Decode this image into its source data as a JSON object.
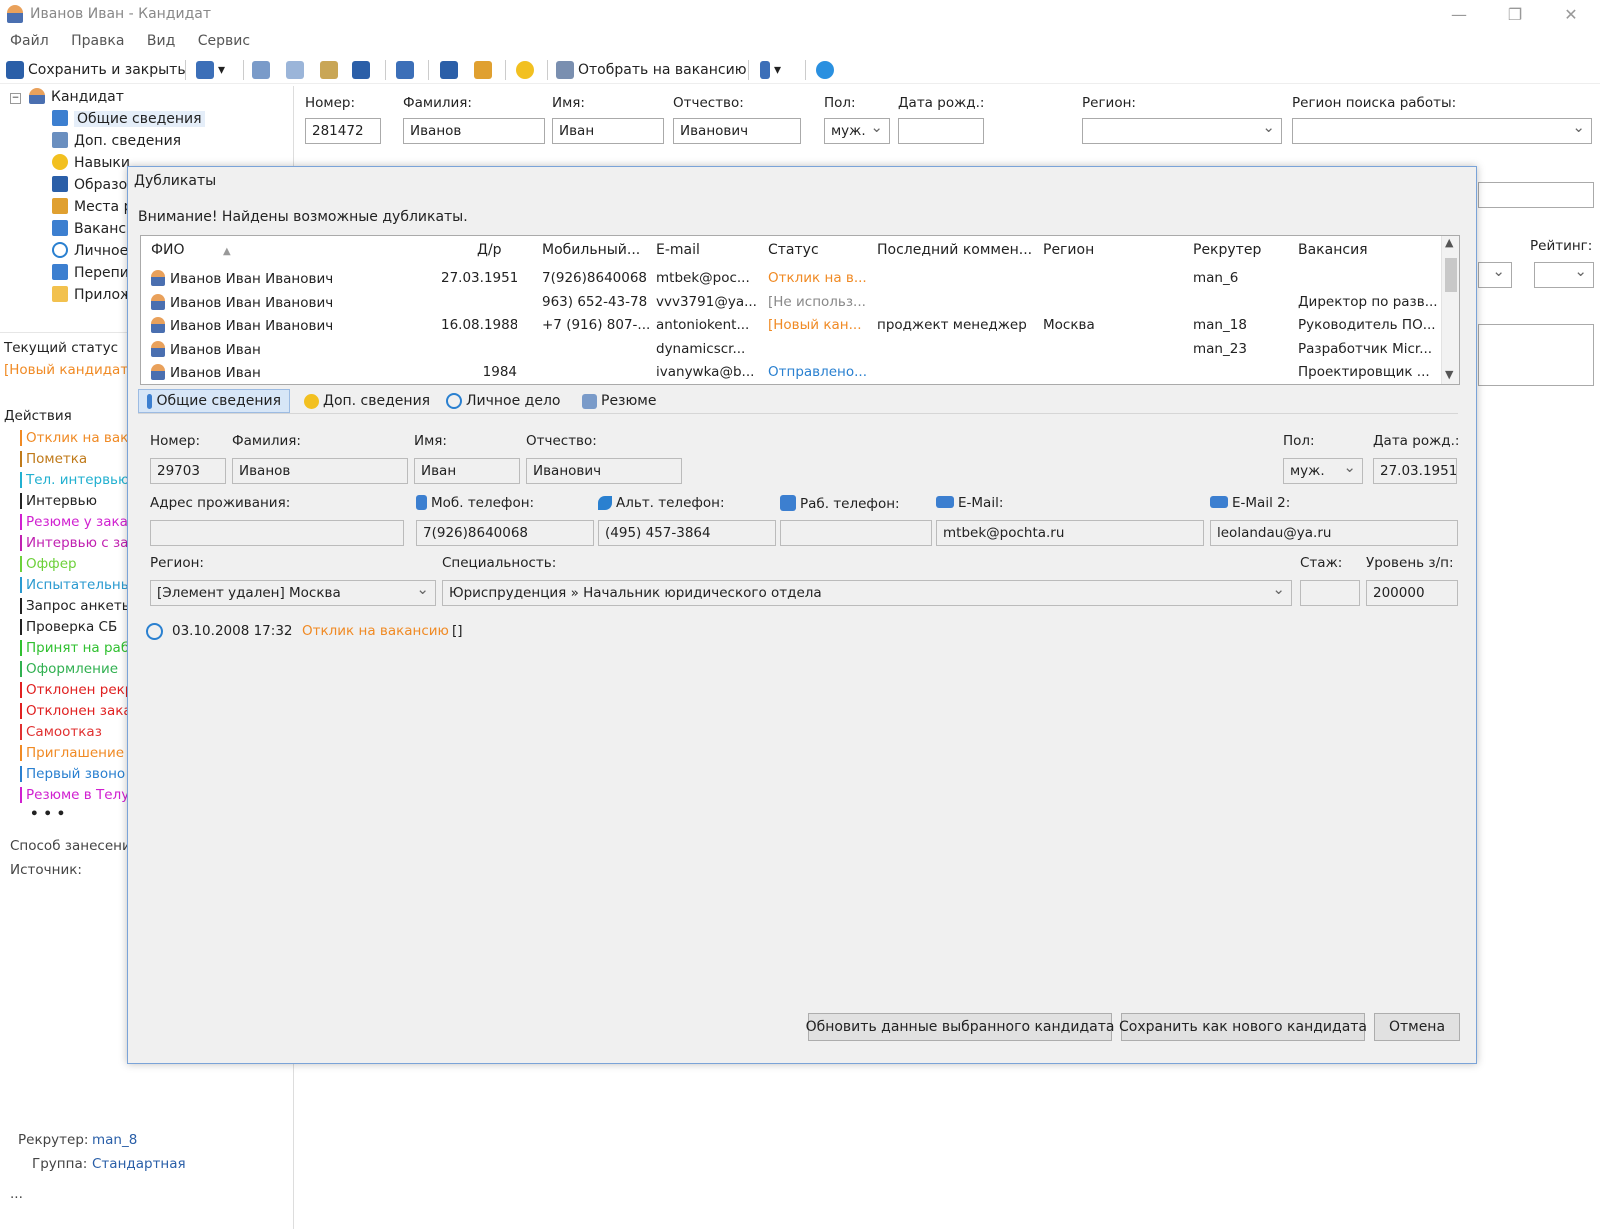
{
  "window": {
    "title": "Иванов Иван - Кандидат"
  },
  "menu": [
    "Файл",
    "Правка",
    "Вид",
    "Сервис"
  ],
  "toolbar": {
    "save_close": "Сохранить и закрыть",
    "assign_vacancy": "Отобрать на вакансию"
  },
  "tree": {
    "root": "Кандидат",
    "items": [
      "Общие сведения",
      "Доп. сведения",
      "Навыки",
      "Образо",
      "Места р",
      "Ваканс",
      "Личное",
      "Перепи",
      "Прилож"
    ]
  },
  "left": {
    "status_label": "Текущий статус",
    "status_value": "[Новый кандидат]",
    "actions_label": "Действия",
    "actions": [
      {
        "t": "Отклик на вака",
        "c": "#f08a24"
      },
      {
        "t": "Пометка",
        "c": "#c07a1a"
      },
      {
        "t": "Тел. интервью",
        "c": "#22b0d0"
      },
      {
        "t": "Интервью",
        "c": "#222222"
      },
      {
        "t": "Резюме у заказ",
        "c": "#d020d0"
      },
      {
        "t": "Интервью с за",
        "c": "#c020b0"
      },
      {
        "t": "Оффер",
        "c": "#6dd03a"
      },
      {
        "t": "Испытательны",
        "c": "#2a9ad0"
      },
      {
        "t": "Запрос анкеты",
        "c": "#222222"
      },
      {
        "t": "Проверка СБ",
        "c": "#222222"
      },
      {
        "t": "Принят на раб",
        "c": "#30c030"
      },
      {
        "t": "Оформление",
        "c": "#30b050"
      },
      {
        "t": "Отклонен рекр",
        "c": "#e02020"
      },
      {
        "t": "Отклонен зака",
        "c": "#e02020"
      },
      {
        "t": "Самоотказ",
        "c": "#e03030"
      },
      {
        "t": "Приглашение",
        "c": "#f08a24"
      },
      {
        "t": "Первый звоно",
        "c": "#2a80d0"
      },
      {
        "t": "Резюме в Телу",
        "c": "#d020d0"
      }
    ],
    "more": "• • •",
    "entry_method": "Способ занесени",
    "source": "Источник:",
    "recruiter_label": "Рекрутер:",
    "recruiter_value": "man_8",
    "group_label": "Группа:",
    "group_value": "Стандартная",
    "dots": "..."
  },
  "bg_form": {
    "labels": {
      "num": "Номер:",
      "last": "Фамилия:",
      "first": "Имя:",
      "middle": "Отчество:",
      "sex": "Пол:",
      "dob": "Дата рожд.:",
      "region": "Регион:",
      "search_region": "Регион поиска работы:",
      "rating": "Рейтинг:"
    },
    "values": {
      "num": "281472",
      "last": "Иванов",
      "first": "Иван",
      "middle": "Иванович",
      "sex": "муж."
    }
  },
  "dialog": {
    "title": "Дубликаты",
    "warning": "Внимание! Найдены возможные дубликаты.",
    "columns": [
      "ФИО",
      "Д/р",
      "Мобильный...",
      "E-mail",
      "Статус",
      "Последний коммен...",
      "Регион",
      "Рекрутер",
      "Вакансия"
    ],
    "rows": [
      {
        "fio": "Иванов Иван Иванович",
        "dob": "27.03.1951",
        "mobile": "7(926)8640068",
        "email": "mtbek@poc...",
        "status": "Отклик на в...",
        "status_color": "#f08a24",
        "comment": "",
        "region": "",
        "recruiter": "man_6",
        "vacancy": ""
      },
      {
        "fio": "Иванов Иван Иванович",
        "dob": "",
        "mobile": "963) 652-43-78",
        "email": "vvv3791@ya...",
        "status": "[Не использ...",
        "status_color": "#888888",
        "comment": "",
        "region": "",
        "recruiter": "",
        "vacancy": "Директор по разв..."
      },
      {
        "fio": "Иванов Иван Иванович",
        "dob": "16.08.1988",
        "mobile": "+7 (916) 807-...",
        "email": "antoniokent...",
        "status": "[Новый кан...",
        "status_color": "#f08a24",
        "comment": "проджект менеджер",
        "region": "Москва",
        "recruiter": "man_18",
        "vacancy": "Руководитель ПО..."
      },
      {
        "fio": "Иванов Иван",
        "dob": "",
        "mobile": "",
        "email": "dynamicscr...",
        "status": "",
        "status_color": "#222222",
        "comment": "",
        "region": "",
        "recruiter": "man_23",
        "vacancy": "Разработчик Micr..."
      },
      {
        "fio": "Иванов Иван",
        "dob": "1984",
        "mobile": "",
        "email": "ivanywka@b...",
        "status": "Отправлено...",
        "status_color": "#2a80d0",
        "comment": "",
        "region": "",
        "recruiter": "",
        "vacancy": "Проектировщик ..."
      }
    ],
    "tabs": [
      "Общие сведения",
      "Доп. сведения",
      "Личное дело",
      "Резюме"
    ],
    "form": {
      "num_label": "Номер:",
      "num": "29703",
      "last_label": "Фамилия:",
      "last": "Иванов",
      "first_label": "Имя:",
      "first": "Иван",
      "middle_label": "Отчество:",
      "middle": "Иванович",
      "sex_label": "Пол:",
      "sex": "муж.",
      "dob_label": "Дата рожд.:",
      "dob": "27.03.1951",
      "address_label": "Адрес проживания:",
      "address": "",
      "mobile_label": "Моб. телефон:",
      "mobile": "7(926)8640068",
      "alt_label": "Альт. телефон:",
      "alt": "(495) 457-3864",
      "work_label": "Раб. телефон:",
      "work": "",
      "email_label": "E-Mail:",
      "email": "mtbek@pochta.ru",
      "email2_label": "E-Mail 2:",
      "email2": "leolandau@ya.ru",
      "region_label": "Регион:",
      "region": "[Элемент удален] Москва",
      "spec_label": "Специальность:",
      "spec": "Юриспруденция  »  Начальник юридического отдела",
      "exp_label": "Стаж:",
      "exp": "",
      "salary_label": "Уровень з/п:",
      "salary": "200000"
    },
    "event": {
      "datetime": "03.10.2008  17:32",
      "text": "Отклик на вакансию",
      "extra": "[]"
    },
    "buttons": {
      "update": "Обновить данные выбранного кандидата",
      "save_new": "Сохранить как нового кандидата",
      "cancel": "Отмена"
    }
  },
  "colors": {
    "accent": "#2a80d0",
    "orange": "#f08a24"
  }
}
